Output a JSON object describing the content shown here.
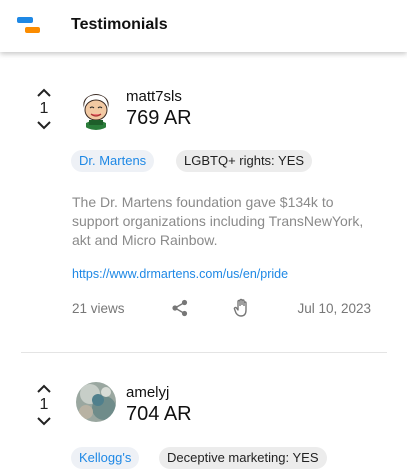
{
  "app": {
    "title": "Testimonials"
  },
  "posts": [
    {
      "votes": "1",
      "username": "matt7sls",
      "score": "769 AR",
      "brand": "Dr. Martens",
      "stance": "LGBTQ+ rights: YES",
      "description": "The Dr. Martens foundation gave $134k to support organizations including TransNewYork, akt and Micro Rainbow.",
      "link": "https://www.drmartens.com/us/en/pride",
      "views": "21 views",
      "date": "Jul 10, 2023"
    },
    {
      "votes": "1",
      "username": "amelyj",
      "score": "704 AR",
      "brand": "Kellogg's",
      "stance": "Deceptive marketing: YES"
    }
  ],
  "colors": {
    "accent": "#1e88e5",
    "logo_orange": "#fb8c00"
  },
  "icons": [
    "upvote-arrow-icon",
    "downvote-arrow-icon",
    "share-icon",
    "raised-hand-icon"
  ]
}
